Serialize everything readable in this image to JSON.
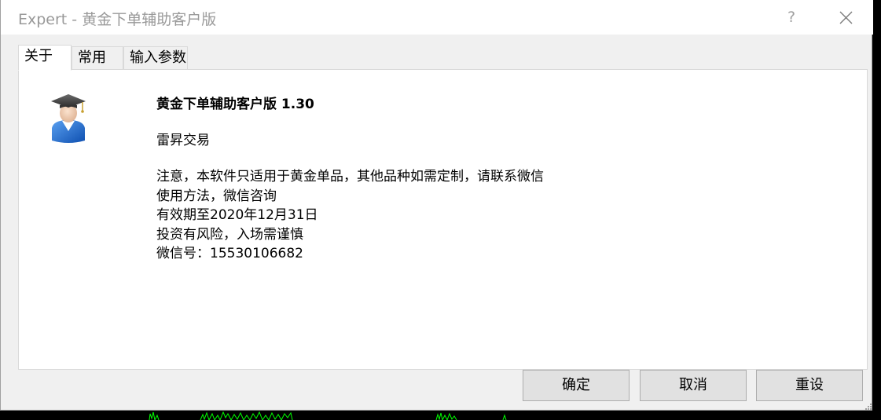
{
  "window": {
    "title": "Expert - 黄金下单辅助客户版",
    "help_label": "?"
  },
  "tabs": [
    {
      "label": "关于"
    },
    {
      "label": "常用"
    },
    {
      "label": "输入参数"
    }
  ],
  "about": {
    "product_title": "黄金下单辅助客户版 1.30",
    "company": "雷昇交易",
    "description_lines": [
      "注意，本软件只适用于黄金单品，其他品种如需定制，请联系微信",
      "使用方法，微信咨询",
      "有效期至2020年12月31日",
      "投资有风险，入场需谨慎",
      "微信号：15530106682"
    ]
  },
  "buttons": {
    "ok": "确定",
    "cancel": "取消",
    "reset": "重设"
  },
  "colors": {
    "background_chart": "#000000",
    "chart_line": "#00ff00",
    "dialog_bg": "#f0f0f0",
    "title_text": "#999999"
  }
}
